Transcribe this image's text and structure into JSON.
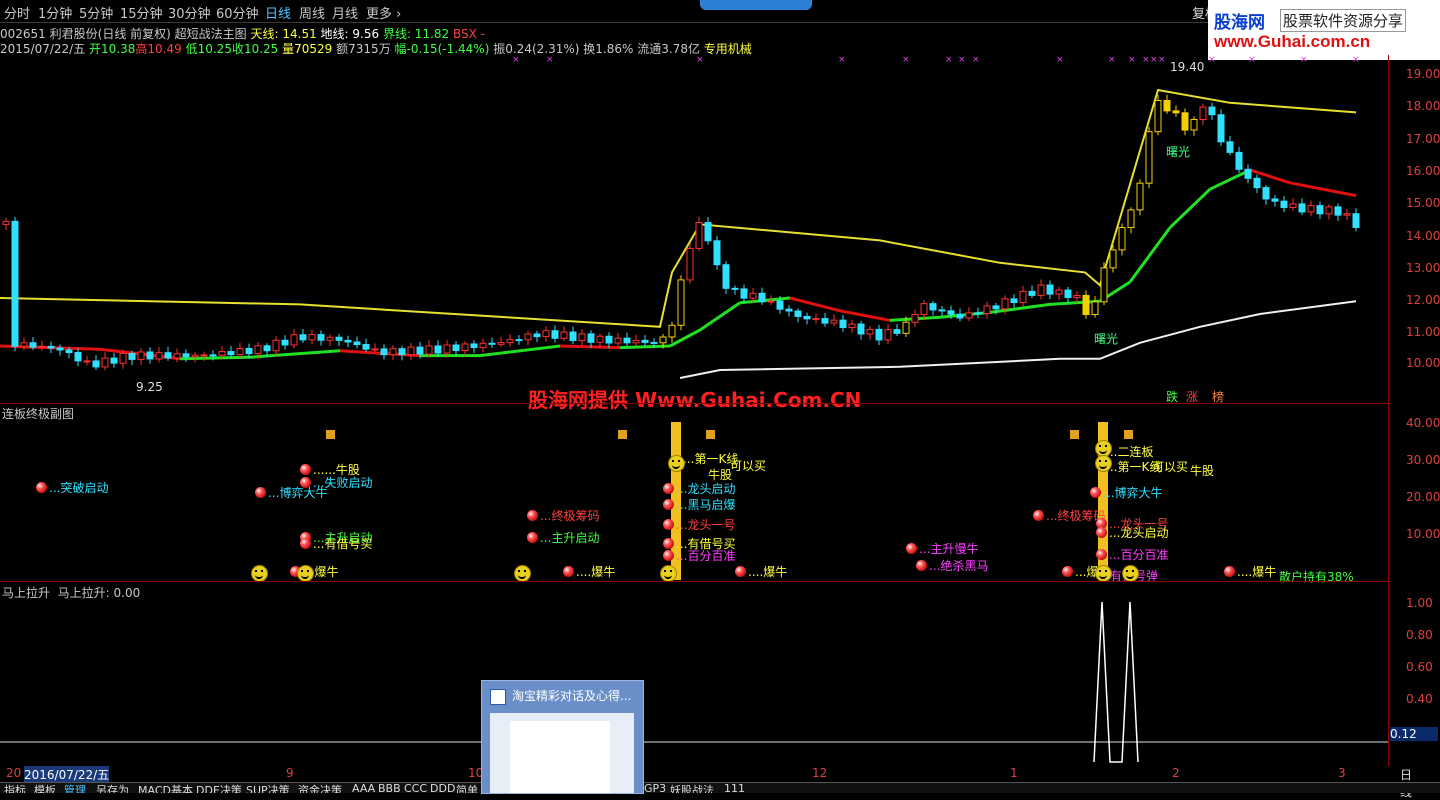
{
  "toolbar": {
    "tabs": [
      "分时",
      "1分钟",
      "5分钟",
      "15分钟",
      "30分钟",
      "60分钟",
      "日线",
      "周线",
      "月线",
      "更多 ›"
    ],
    "active": "日线",
    "fuquan": "复权"
  },
  "brand": {
    "cn": "股海网",
    "slogan": "股票软件资源分享",
    "url": "www.Guhai.com.cn"
  },
  "header": {
    "code": "002651",
    "name": "利君股份(日线 前复权)",
    "formula": "超短战法主图",
    "tian": "天线: 14.51",
    "di": "地线: 9.56",
    "jie": "界线: 11.82",
    "bsx": "BSX -",
    "date": "2015/07/22/五",
    "open": "开10.38",
    "high": "高10.49",
    "low": "低10.25",
    "close": "收10.25",
    "vol": "量70529",
    "amt": "额7315万",
    "change": "幅-0.15(-1.44%)",
    "amp": "振0.24(2.31%)",
    "turn": "换1.86%",
    "float": "流通3.78亿",
    "industry": "专用机械"
  },
  "main_axis": [
    "19.00",
    "18.00",
    "17.00",
    "16.00",
    "15.00",
    "14.00",
    "13.00",
    "12.00",
    "11.00",
    "10.00"
  ],
  "annotations": {
    "high": "19.40",
    "low": "9.25",
    "dawn1": "曙光",
    "dawn2": "曙光",
    "die": "跌",
    "zhang": "涨",
    "bang": "榜"
  },
  "watermark": "股海网提供 Www.Guhai.Com.CN",
  "sub1": {
    "title": "连板终极副图",
    "axis": [
      "40.00",
      "30.00",
      "20.00",
      "10.00"
    ],
    "signals": [
      "突破启动",
      "牛股",
      "博弈大牛",
      "失败启动",
      "终极筹码",
      "主升启动",
      "主升启动",
      "有借号买",
      "爆牛",
      "爆牛",
      "爆牛",
      "第一K线",
      "可以买",
      "牛股",
      "龙头启动",
      "黑马启爆",
      "龙头一号",
      "有借号买",
      "百分百准",
      "主升慢牛",
      "绝杀黑马",
      "终极筹码",
      "二连板",
      "第一K线",
      "可以买",
      "牛股",
      "博弈大牛",
      "龙头一号",
      "龙头启动",
      "百分百准",
      "爆牛",
      "有借号弹",
      "爆牛",
      "散户持有38%"
    ]
  },
  "sub2": {
    "title": "马上拉升",
    "value_label": "马上拉升: 0.00",
    "axis": [
      "1.00",
      "0.80",
      "0.60",
      "0.40"
    ],
    "current": "0.12"
  },
  "xaxis": {
    "labels": [
      "2016/07/22/五",
      "9",
      "10",
      "12",
      "1",
      "2",
      "3"
    ],
    "period": "日线"
  },
  "bottombar": [
    "指标",
    "模板",
    "管理",
    "另存为",
    "MACD基本",
    "DDE决策",
    "SUP决策",
    "资金决策",
    "AAA",
    "BBB",
    "CCC",
    "DDD",
    "简单",
    "GP3",
    "妖股战法",
    "111"
  ],
  "popup": {
    "title": "淘宝精彩对话及心得..."
  }
}
